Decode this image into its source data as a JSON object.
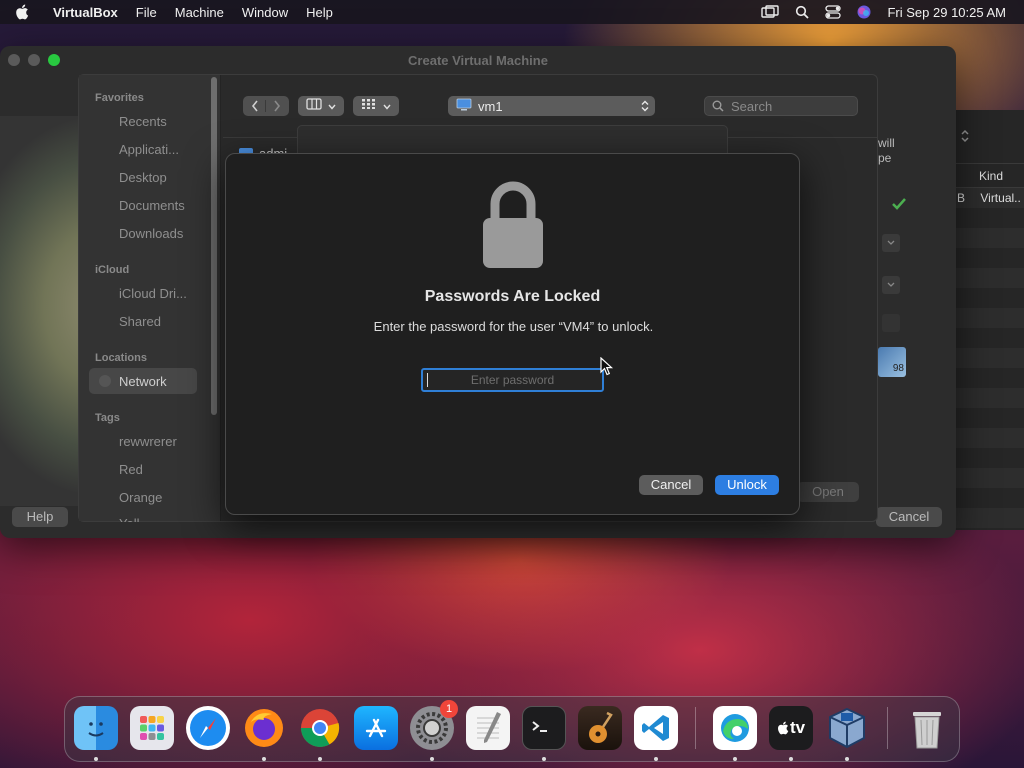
{
  "menubar": {
    "app_name": "VirtualBox",
    "menus": [
      "File",
      "Machine",
      "Window",
      "Help"
    ],
    "datetime": "Fri Sep 29  10:25 AM"
  },
  "main_window": {
    "title": "Create Virtual Machine",
    "help_label": "Help",
    "cancel_label": "Cancel",
    "partial_text_1": "will",
    "partial_text_2": "pe",
    "kind_header": "Kind",
    "kind_row_prefix": "B",
    "kind_row_value": "Virtual..",
    "badge_number": "98"
  },
  "open_dialog": {
    "sidebar": {
      "favorites_header": "Favorites",
      "favorites": [
        "Recents",
        "Applicati...",
        "Desktop",
        "Documents",
        "Downloads"
      ],
      "icloud_header": "iCloud",
      "icloud": [
        "iCloud Dri...",
        "Shared"
      ],
      "locations_header": "Locations",
      "locations": [
        "Network"
      ],
      "tags_header": "Tags",
      "tags": [
        "rewwrerer",
        "Red",
        "Orange",
        "Yell..."
      ]
    },
    "location": "vm1",
    "search_placeholder": "Search",
    "partial_file": "admi",
    "open_label": "Open"
  },
  "sheet": {
    "heading": "Passwords Are Locked",
    "message": "Enter the password for the user “VM4” to unlock.",
    "password_placeholder": "Enter password",
    "password_value": "",
    "cancel_label": "Cancel",
    "unlock_label": "Unlock"
  },
  "dock": {
    "settings_badge": "1",
    "tv_label": "tv"
  },
  "colors": {
    "accent_blue": "#2d7ee2",
    "focus_ring": "#2f7fd6",
    "traffic_red": "#ff5f57",
    "traffic_yellow": "#febc2e",
    "traffic_green": "#28c840",
    "check_green": "#4caf50"
  }
}
